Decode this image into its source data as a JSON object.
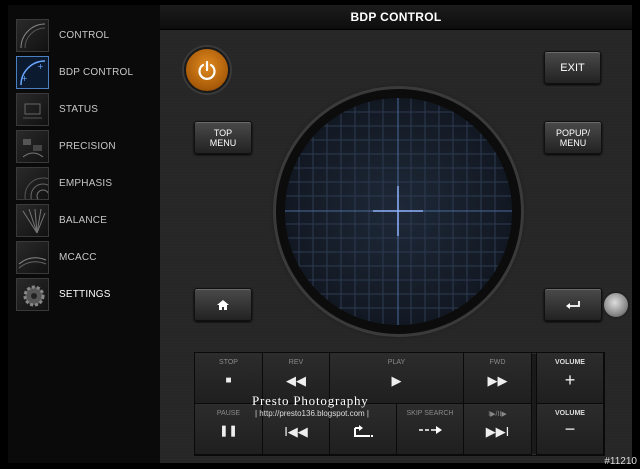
{
  "title": "BDP CONTROL",
  "sidebar": {
    "items": [
      {
        "label": "CONTROL",
        "icon": "arc-gauge-icon"
      },
      {
        "label": "BDP CONTROL",
        "icon": "quadrant-pad-icon"
      },
      {
        "label": "STATUS",
        "icon": "status-icon"
      },
      {
        "label": "PRECISION",
        "icon": "precision-icon"
      },
      {
        "label": "EMPHASIS",
        "icon": "emphasis-icon"
      },
      {
        "label": "BALANCE",
        "icon": "balance-icon"
      },
      {
        "label": "MCACC",
        "icon": "mcacc-icon"
      },
      {
        "label": "SETTINGS",
        "icon": "gear-icon"
      }
    ]
  },
  "buttons": {
    "exit": "EXIT",
    "top_menu": "TOP MENU",
    "popup_menu": "POPUP/ MENU"
  },
  "transport": {
    "stop": "STOP",
    "rev": "REV",
    "play": "PLAY",
    "fwd": "FWD",
    "volume_up": "VOLUME",
    "pause": "PAUSE",
    "skip_search": "SKIP SEARCH",
    "step": "I▶/II▶",
    "volume_down": "VOLUME"
  },
  "watermark": {
    "name": "Presto Photography",
    "url": "| http://presto136.blogspot.com |"
  },
  "badge": "#11210",
  "colors": {
    "accent": "#e08a20",
    "grid": "#4a6a9a"
  }
}
